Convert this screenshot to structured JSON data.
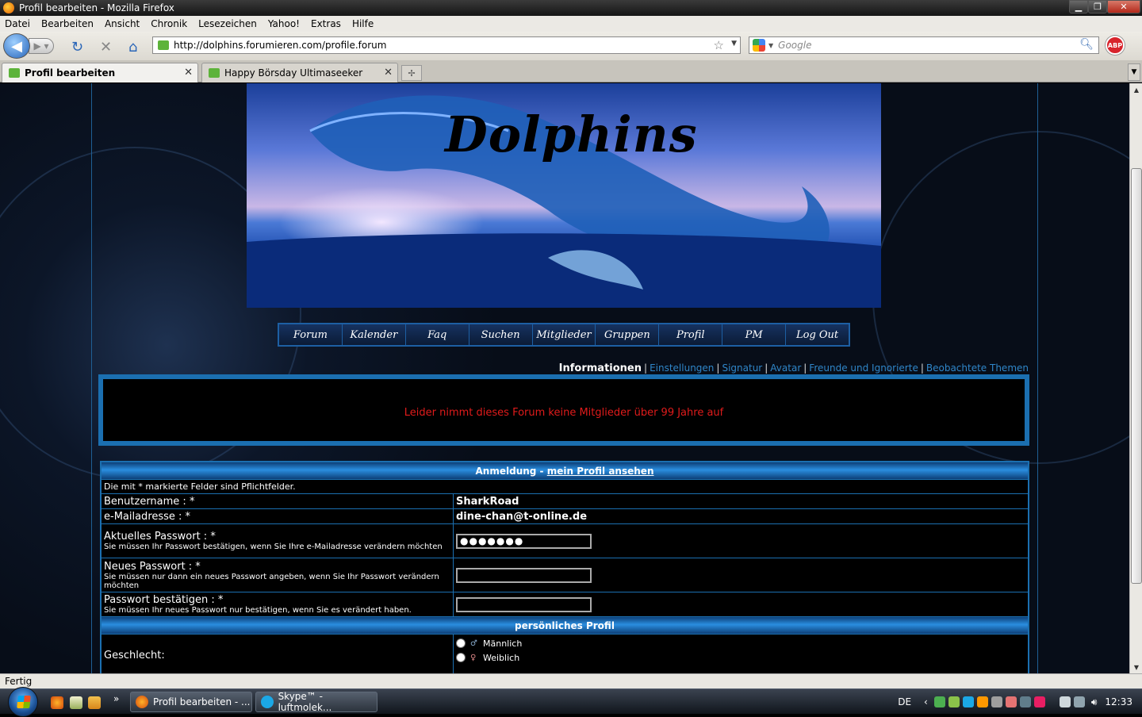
{
  "window": {
    "title": "Profil bearbeiten - Mozilla Firefox"
  },
  "menu": [
    "Datei",
    "Bearbeiten",
    "Ansicht",
    "Chronik",
    "Lesezeichen",
    "Yahoo!",
    "Extras",
    "Hilfe"
  ],
  "navigation": {
    "url": "http://dolphins.forumieren.com/profile.forum",
    "search_placeholder": "Google",
    "addon_label": "ABP"
  },
  "tabs": [
    {
      "label": "Profil bearbeiten",
      "active": true
    },
    {
      "label": "Happy Börsday Ultimaseeker",
      "active": false
    }
  ],
  "banner": {
    "title": "Dolphins"
  },
  "forum_nav": [
    "Forum",
    "Kalender",
    "Faq",
    "Suchen",
    "Mitglieder",
    "Gruppen",
    "Profil",
    "PM",
    "Log Out"
  ],
  "profile_tabs": {
    "active": "Informationen",
    "links": [
      "Einstellungen",
      "Signatur",
      "Avatar",
      "Freunde und Ignorierte",
      "Beobachtete Themen"
    ]
  },
  "error_message": "Leider nimmt dieses Forum keine Mitglieder über 99 Jahre auf",
  "form": {
    "header_prefix": "Anmeldung - ",
    "header_link": "mein Profil ansehen",
    "required_note": "Die mit * markierte Felder sind Pflichtfelder.",
    "username_label": "Benutzername : *",
    "username_value": "SharkRoad",
    "email_label": "e-Mailadresse : *",
    "email_value": "dine-chan@t-online.de",
    "current_pw_label": "Aktuelles Passwort : *",
    "current_pw_hint": "Sie müssen Ihr Passwort bestätigen, wenn Sie Ihre e-Mailadresse verändern möchten",
    "current_pw_value": "●●●●●●●",
    "new_pw_label": "Neues Passwort : *",
    "new_pw_hint": "Sie müssen nur dann ein neues Passwort angeben, wenn Sie Ihr Passwort verändern möchten",
    "confirm_pw_label": "Passwort bestätigen : *",
    "confirm_pw_hint": "Sie müssen Ihr neues Passwort nur bestätigen, wenn Sie es verändert haben.",
    "personal_header": "persönliches Profil",
    "gender_label": "Geschlecht:",
    "gender_male": "Männlich",
    "gender_female": "Weiblich"
  },
  "status": "Fertig",
  "taskbar": {
    "buttons": [
      "Profil bearbeiten - ...",
      "Skype™ - luftmolek..."
    ],
    "language": "DE",
    "clock": "12:33"
  },
  "colors": {
    "accent": "#1b6fb0",
    "link": "#2f86c9",
    "error": "#e01b1b"
  }
}
